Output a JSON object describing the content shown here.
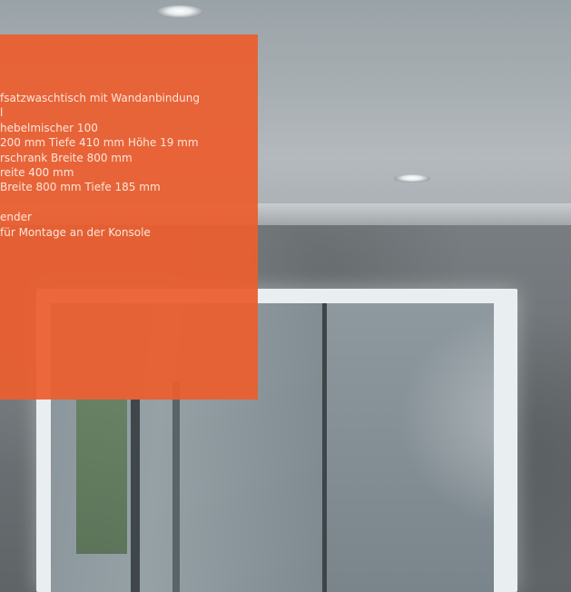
{
  "overlay": {
    "color": "#ec5e2e",
    "text_color": "#fde4da",
    "lines": [
      "fsatzwaschtisch mit Wandanbindung",
      "l",
      "hebelmischer 100",
      "200 mm Tiefe 410 mm Höhe 19 mm",
      "rschrank Breite 800 mm",
      "reite 400 mm",
      "Breite 800 mm Tiefe 185 mm",
      "",
      "ender",
      " für Montage an der Konsole"
    ]
  },
  "scene": {
    "wall_color": "#6f7579",
    "ceiling_color": "#a6adb1",
    "mirror_frame_color": "#e9eef1"
  }
}
